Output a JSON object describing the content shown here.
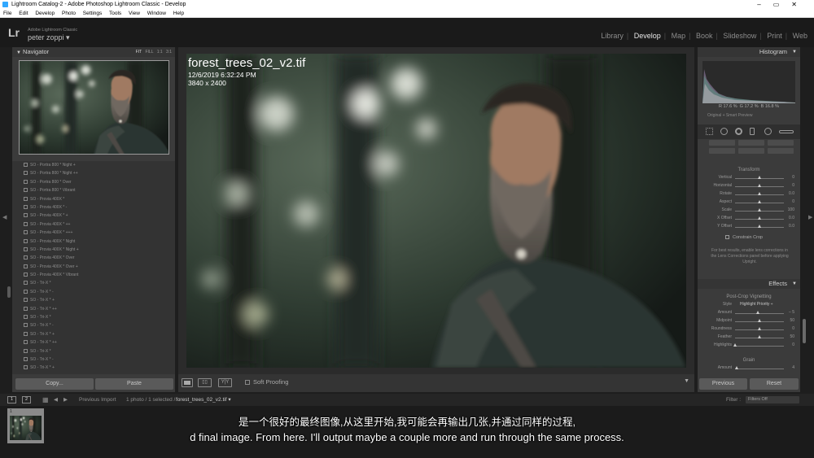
{
  "window": {
    "title": "Lightroom Catalog-2 - Adobe Photoshop Lightroom Classic - Develop",
    "controls": [
      "–",
      "▭",
      "✕"
    ]
  },
  "menu": [
    "File",
    "Edit",
    "Develop",
    "Photo",
    "Settings",
    "Tools",
    "View",
    "Window",
    "Help"
  ],
  "identity": {
    "logo": "Lr",
    "app": "Adobe Lightroom Classic",
    "user": "peter zoppi ▾"
  },
  "modules": [
    "Library",
    "Develop",
    "Map",
    "Book",
    "Slideshow",
    "Print",
    "Web"
  ],
  "active_module": "Develop",
  "navigator": {
    "title": "Navigator",
    "zoom": [
      "FIT",
      "FILL",
      "1:1",
      "3:1"
    ]
  },
  "presets": [
    "SO - Portra 800 * Night +",
    "SO - Portra 800 * Night ++",
    "SO - Portra 800 * Over",
    "SO - Portra 800 * Vibrant",
    "SO - Provia 400X *",
    "SO - Provia 400X * -",
    "SO - Provia 400X * +",
    "SO - Provia 400X * ++",
    "SO - Provia 400X * +++",
    "SO - Provia 400X * Night",
    "SO - Provia 400X * Night +",
    "SO - Provia 400X * Over",
    "SO - Provia 400X * Over +",
    "SO - Provia 400X * Vibrant",
    "SO - Tri-X *",
    "SO - Tri-X * -",
    "SO - Tri-X * +",
    "SO - Tri-X * ++",
    "SO - Tri-X *",
    "SO - Tri-X * -",
    "SO - Tri-X * +",
    "SO - Tri-X * ++",
    "SO - Tri-X *",
    "SO - Tri-X * -",
    "SO - Tri-X * +"
  ],
  "left_buttons": {
    "copy": "Copy...",
    "paste": "Paste"
  },
  "photo": {
    "filename": "forest_trees_02_v2.tif",
    "datetime": "12/6/2019 6:32:24 PM",
    "dimensions": "3840 x 2400"
  },
  "toolbar": {
    "soft_proofing": "Soft Proofing",
    "compare": "Y|Y",
    "before_after": "▯▯"
  },
  "histogram": {
    "title": "Histogram",
    "R": "17.6",
    "G": "17.2",
    "B": "16.8",
    "original_preview": "Original + Smart Preview"
  },
  "transform": {
    "title": "Transform",
    "rows": [
      {
        "label": "Vertical",
        "value": "0",
        "level": 0.5
      },
      {
        "label": "Horizontal",
        "value": "0",
        "level": 0.5
      },
      {
        "label": "Rotate",
        "value": "0.0",
        "level": 0.5
      },
      {
        "label": "Aspect",
        "value": "0",
        "level": 0.5
      },
      {
        "label": "Scale",
        "value": "100",
        "level": 0.5
      },
      {
        "label": "X Offset",
        "value": "0.0",
        "level": 0.5
      },
      {
        "label": "Y Offset",
        "value": "0.0",
        "level": 0.5
      }
    ],
    "constrain": "Constrain Crop",
    "hint": "For best results, enable lens corrections in the Lens Corrections panel before applying Upright."
  },
  "effects": {
    "title": "Effects",
    "vignette_title": "Post-Crop Vignetting",
    "style_label": "Style",
    "style_value": "Highlight Priority ÷",
    "rows": [
      {
        "label": "Amount",
        "value": "– 5",
        "level": 0.47
      },
      {
        "label": "Midpoint",
        "value": "50",
        "level": 0.5
      },
      {
        "label": "Roundness",
        "value": "0",
        "level": 0.5
      },
      {
        "label": "Feather",
        "value": "50",
        "level": 0.5
      },
      {
        "label": "Highlights",
        "value": "0",
        "level": 0.0
      }
    ],
    "grain_title": "Grain",
    "grain_rows": [
      {
        "label": "Amount",
        "value": "4",
        "level": 0.04
      }
    ]
  },
  "right_buttons": {
    "previous": "Previous",
    "reset": "Reset"
  },
  "filmstrip": {
    "page1": "1",
    "page2": "2",
    "source": "Previous Import",
    "selection": "1 photo / 1 selected /",
    "selected_file": "forest_trees_02_v2.tif ▾",
    "filter_label": "Filter :",
    "filter_value": "Filters Off",
    "thumb_index": "1"
  },
  "subtitles": {
    "zh": "是一个很好的最终图像,从这里开始,我可能会再输出几张,并通过同样的过程,",
    "en": "d final image. From here. I'll output maybe a couple more and run through the same process."
  },
  "colors": {
    "panel": "#3b3b3b",
    "background": "#1e1e1e",
    "active_text": "#e6e6e6"
  }
}
